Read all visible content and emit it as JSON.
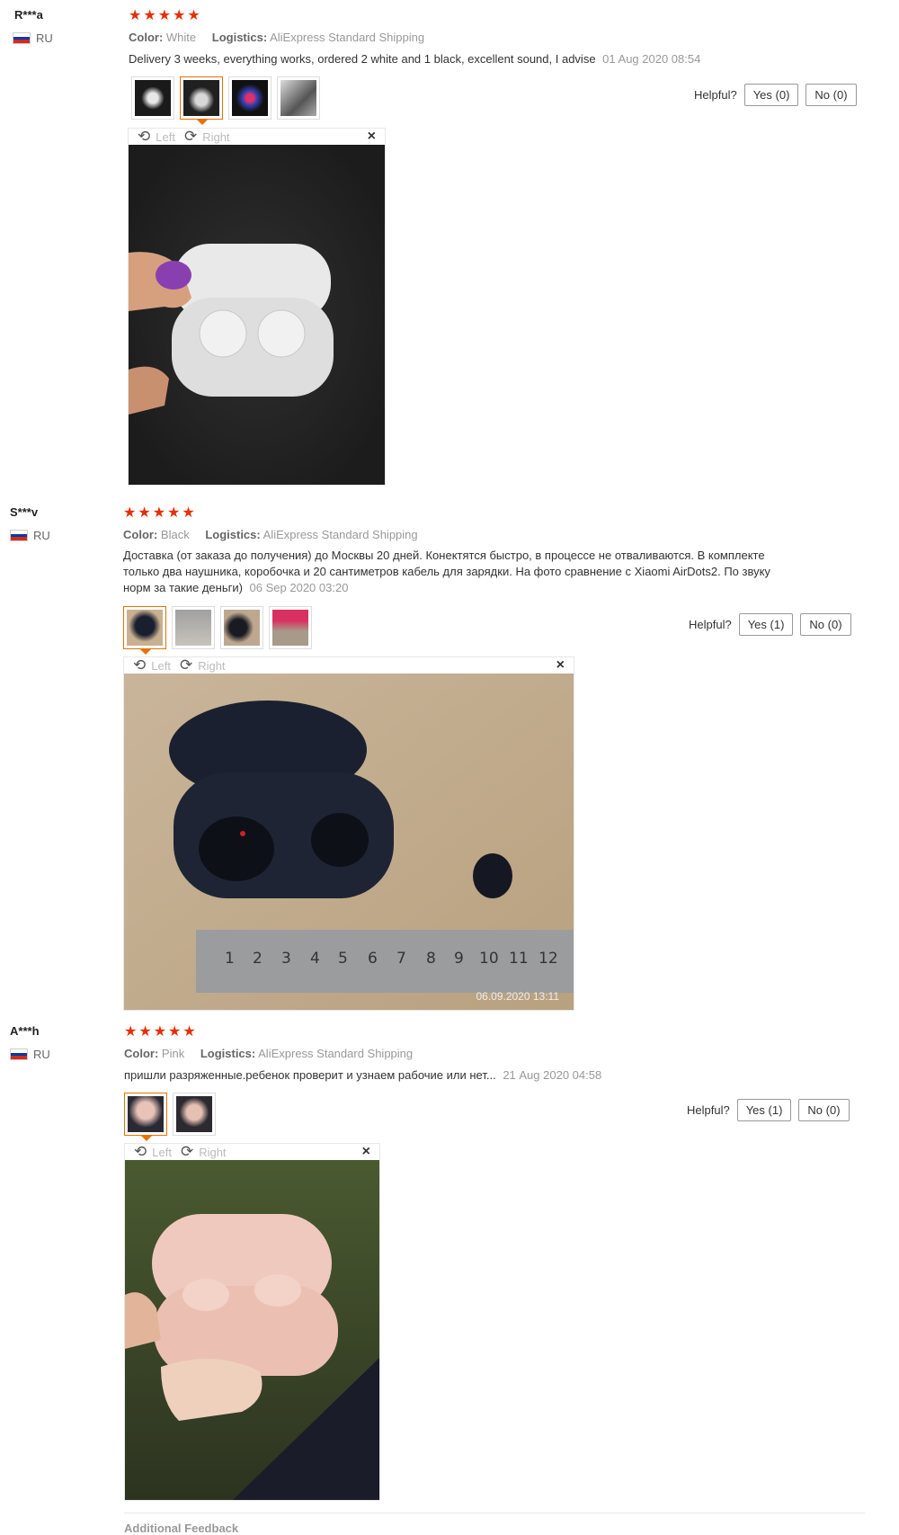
{
  "reviews": [
    {
      "user": "R***a",
      "country": "RU",
      "stars": "★★★★★",
      "color_label": "Color:",
      "color_value": "White",
      "logistics_label": "Logistics:",
      "logistics_value": "AliExpress Standard Shipping",
      "text": "Delivery 3 weeks, everything works, ordered 2 white and 1 black, excellent sound, I advise",
      "date": "01 Aug 2020 08:54",
      "helpful_label": "Helpful?",
      "yes": "Yes (0)",
      "no": "No (0)",
      "left": "Left",
      "right": "Right",
      "close": "×"
    },
    {
      "user": "S***v",
      "country": "RU",
      "stars": "★★★★★",
      "color_label": "Color:",
      "color_value": "Black",
      "logistics_label": "Logistics:",
      "logistics_value": "AliExpress Standard Shipping",
      "text": "Доставка (от заказа до получения) до Москвы 20 дней. Конектятся быстро, в процессе не отваливаются. В комплекте только два наушника, коробочка и 20 сантиметров кабель для зарядки. На фото сравнение с Xiaomi AirDots2. По звуку норм за такие деньги)",
      "date": "06 Sep 2020 03:20",
      "helpful_label": "Helpful?",
      "yes": "Yes (1)",
      "no": "No (0)",
      "left": "Left",
      "right": "Right",
      "close": "×",
      "photo_timestamp": "06.09.2020 13:11"
    },
    {
      "user": "A***h",
      "country": "RU",
      "stars": "★★★★★",
      "color_label": "Color:",
      "color_value": "Pink",
      "logistics_label": "Logistics:",
      "logistics_value": "AliExpress Standard Shipping",
      "text": "пришли разряженные.ребенок проверит и узнаем рабочие или нет...",
      "date": "21 Aug 2020 04:58",
      "helpful_label": "Helpful?",
      "yes": "Yes (1)",
      "no": "No (0)",
      "left": "Left",
      "right": "Right",
      "close": "×"
    }
  ],
  "additional_feedback": "Additional Feedback",
  "colors": {
    "star": "#e62e04",
    "active_thumb": "#e67300",
    "flag_white": "#ffffff",
    "flag_blue": "#0039a6",
    "flag_red": "#d52b1e"
  }
}
